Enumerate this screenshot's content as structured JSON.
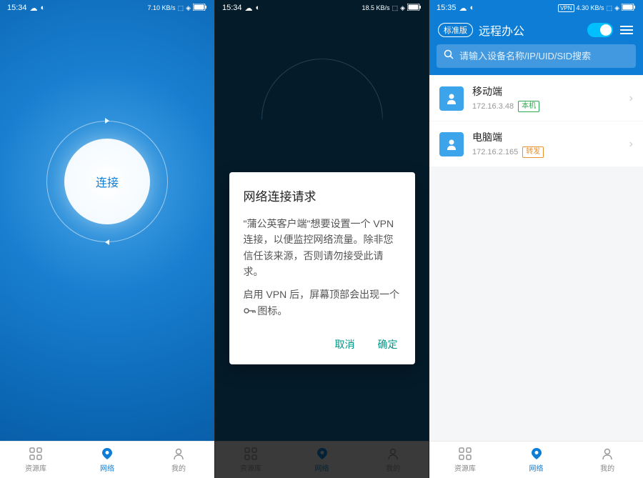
{
  "screen1": {
    "status_time": "15:34",
    "status_speed": "7.10 KB/s",
    "status_battery": "100",
    "connect_label": "连接",
    "nav": {
      "resources": "资源库",
      "network": "网络",
      "mine": "我的"
    }
  },
  "screen2": {
    "status_time": "15:34",
    "status_speed": "18.5 KB/s",
    "status_battery": "100",
    "dialog": {
      "title": "网络连接请求",
      "body1": "\"蒲公英客户端\"想要设置一个 VPN 连接，以便监控网络流量。除非您信任该来源，否则请勿接受此请求。",
      "body2_prefix": "启用 VPN 后，屏幕顶部会出现一个 ",
      "body2_suffix": " 图标。",
      "cancel": "取消",
      "confirm": "确定"
    },
    "nav": {
      "resources": "资源库",
      "network": "网络",
      "mine": "我的"
    }
  },
  "screen3": {
    "status_time": "15:35",
    "status_speed": "4.30 KB/s",
    "status_battery": "100",
    "vpn_badge": "VPN",
    "header": {
      "badge": "标准版",
      "title": "远程办公"
    },
    "search_placeholder": "请输入设备名称/IP/UID/SID搜索",
    "devices": [
      {
        "name": "移动端",
        "ip": "172.16.3.48",
        "tag": "本机",
        "tag_class": "tag-green"
      },
      {
        "name": "电脑端",
        "ip": "172.16.2.165",
        "tag": "转发",
        "tag_class": "tag-orange"
      }
    ],
    "nav": {
      "resources": "资源库",
      "network": "网络",
      "mine": "我的"
    }
  }
}
